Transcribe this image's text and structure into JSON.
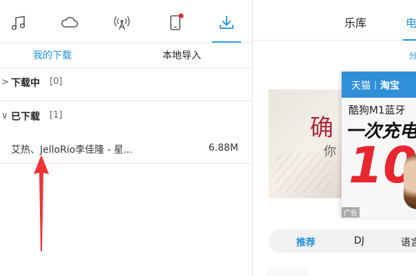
{
  "icon_bar": {
    "icons": [
      "music-note-icon",
      "cloud-icon",
      "radio-broadcast-icon",
      "phone-device-icon",
      "download-icon"
    ],
    "active": "download-icon",
    "notification_color": "#e8262f",
    "accent": "#2b9de8"
  },
  "subtabs": {
    "my_downloads": "我的下载",
    "local_import": "本地导入"
  },
  "downloading": {
    "title": "下载中",
    "count": "[0]"
  },
  "downloaded": {
    "title": "已下载",
    "count": "[1]"
  },
  "file": {
    "name": "艾热、JelloRio李佳隆 - 星...",
    "size": "6.88M"
  },
  "annotation": {
    "arrow_color": "#ee3333"
  },
  "right_tabs": {
    "library": "乐库",
    "second": "电"
  },
  "right_subtab_partial": "分",
  "banner": {
    "back_text_big": "确",
    "back_text_small": "你",
    "ad": {
      "brand_1": "天猫",
      "separator": "|",
      "brand_2": "淘宝",
      "line1": "酷狗M1蓝牙",
      "line2": "一次充电",
      "number": "10",
      "tag": "广告"
    }
  },
  "category_pill": {
    "items": [
      "推荐",
      "DJ",
      "语言"
    ],
    "active": "推荐"
  }
}
